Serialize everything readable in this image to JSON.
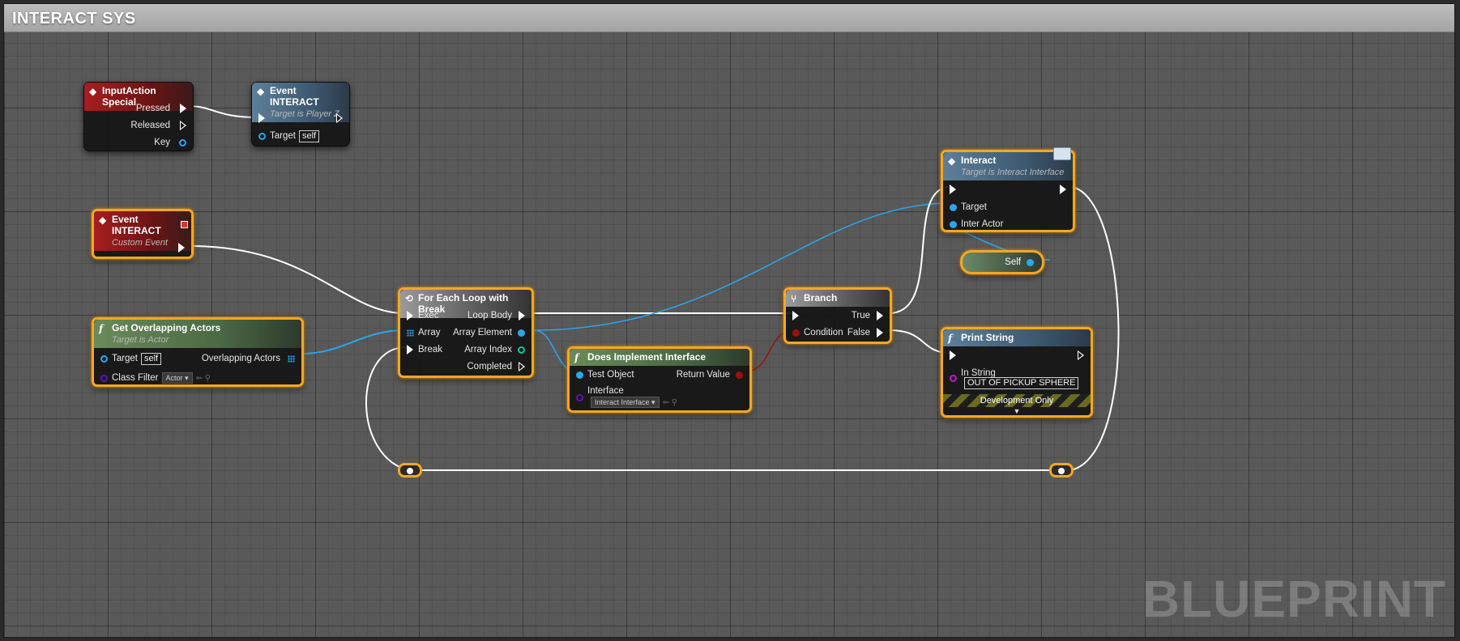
{
  "title": "INTERACT SYS",
  "watermark": "BLUEPRINT",
  "nodes": {
    "input_action": {
      "title": "InputAction Special",
      "pressed": "Pressed",
      "released": "Released",
      "key": "Key"
    },
    "event_interact_call": {
      "title": "Event INTERACT",
      "subtitle": "Target is Player Z",
      "target": "Target",
      "target_value": "self"
    },
    "custom_event": {
      "title": "Event INTERACT",
      "subtitle": "Custom Event"
    },
    "get_overlapping": {
      "title": "Get Overlapping Actors",
      "subtitle": "Target is Actor",
      "target": "Target",
      "target_value": "self",
      "overlapping": "Overlapping Actors",
      "class_filter": "Class Filter",
      "class_filter_value": "Actor"
    },
    "for_each": {
      "title": "For Each Loop with Break",
      "exec": "Exec",
      "array": "Array",
      "break": "Break",
      "loop_body": "Loop Body",
      "array_element": "Array Element",
      "array_index": "Array Index",
      "completed": "Completed"
    },
    "does_implement": {
      "title": "Does Implement Interface",
      "test_object": "Test Object",
      "return_value": "Return Value",
      "interface": "Interface",
      "interface_value": "Interact Interface"
    },
    "branch": {
      "title": "Branch",
      "true": "True",
      "condition": "Condition",
      "false": "False"
    },
    "interact": {
      "title": "Interact",
      "subtitle": "Target is Interact Interface",
      "target": "Target",
      "inter_actor": "Inter Actor"
    },
    "self_node": {
      "label": "Self"
    },
    "print_string": {
      "title": "Print String",
      "in_string": "In String",
      "in_string_value": "OUT OF PICKUP SPHERE",
      "dev_only": "Development Only"
    }
  },
  "colors": {
    "selection": "#f5a623",
    "exec_wire": "#ffffff",
    "object_wire": "#2aa6ea",
    "bool_wire": "#9e0f0f"
  }
}
